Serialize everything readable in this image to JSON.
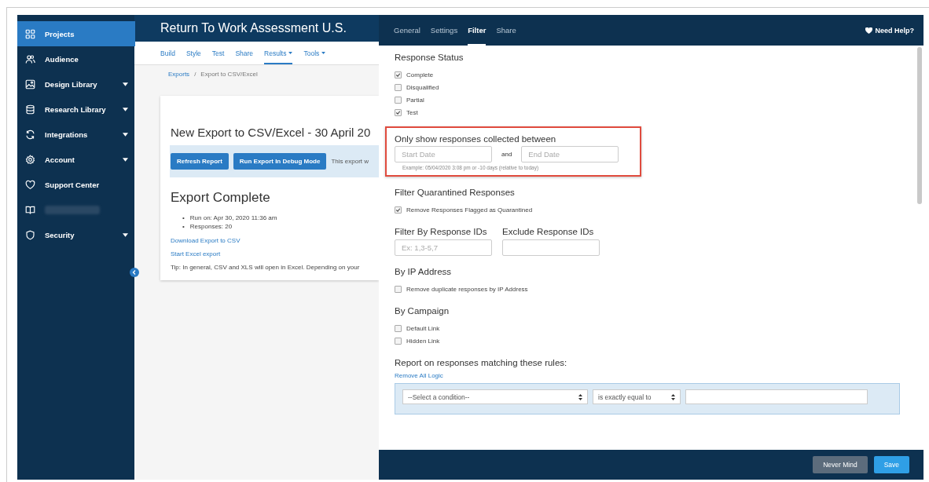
{
  "sidebar": {
    "items": [
      {
        "kind": "link",
        "label": "Projects",
        "selected": true,
        "expandable": false
      },
      {
        "kind": "link",
        "label": "Audience",
        "selected": false,
        "expandable": false
      },
      {
        "kind": "link",
        "label": "Design Library",
        "selected": false,
        "expandable": true
      },
      {
        "kind": "link",
        "label": "Research Library",
        "selected": false,
        "expandable": true
      },
      {
        "kind": "link",
        "label": "Integrations",
        "selected": false,
        "expandable": true
      },
      {
        "kind": "link",
        "label": "Account",
        "selected": false,
        "expandable": true
      },
      {
        "kind": "link",
        "label": "Support Center",
        "selected": false,
        "expandable": false
      },
      {
        "kind": "redacted",
        "selected": false,
        "expandable": false
      },
      {
        "kind": "link",
        "label": "Security",
        "selected": false,
        "expandable": true
      }
    ]
  },
  "project": {
    "title": "Return To Work Assessment U.S.",
    "nav": [
      {
        "label": "Build",
        "selected": false,
        "menu": false
      },
      {
        "label": "Style",
        "selected": false,
        "menu": false
      },
      {
        "label": "Test",
        "selected": false,
        "menu": false
      },
      {
        "label": "Share",
        "selected": false,
        "menu": false
      },
      {
        "label": "Results",
        "selected": true,
        "menu": true
      },
      {
        "label": "Tools",
        "selected": false,
        "menu": true
      }
    ],
    "breadcrumb": [
      {
        "label": "Exports",
        "link": true
      },
      {
        "label": "/",
        "link": false
      },
      {
        "label": "Export to CSV/Excel",
        "link": false
      }
    ],
    "card": {
      "title": "New Export to CSV/Excel - 30 April 20",
      "buttons": [
        "Refresh Report",
        "Run Export In Debug Mode"
      ],
      "notice": "This export w",
      "status": "Export Complete",
      "details": [
        {
          "bullet": "•",
          "text": "Run on: Apr 30, 2020 11:36 am"
        },
        {
          "bullet": "•",
          "text": "Responses: 20"
        }
      ],
      "links": [
        "Download Export to CSV",
        "Start Excel export"
      ],
      "tip": "Tip: In general, CSV and XLS will open in Excel. Depending on your"
    }
  },
  "filter_panel": {
    "tabs": [
      {
        "label": "General",
        "selected": false
      },
      {
        "label": "Settings",
        "selected": false
      },
      {
        "label": "Filter",
        "selected": true
      },
      {
        "label": "Share",
        "selected": false
      }
    ],
    "help": "Need Help?",
    "sections": [
      {
        "kind": "checkboxes",
        "heading": "Response Status",
        "options": [
          {
            "label": "Complete",
            "checked": true
          },
          {
            "label": "Disqualified",
            "checked": false
          },
          {
            "label": "Partial",
            "checked": false
          },
          {
            "label": "Test",
            "checked": true
          }
        ]
      },
      {
        "kind": "date_range",
        "heading": "Only show responses collected between",
        "highlighted": true,
        "start_placeholder": "Start Date",
        "joiner": "and",
        "end_placeholder": "End Date",
        "hint": "Example: 05/04/2020 3:08 pm or -10 days (relative to today)"
      },
      {
        "kind": "checkboxes",
        "heading": "Filter Quarantined Responses",
        "options": [
          {
            "label": "Remove Responses Flagged as Quarantined",
            "checked": true
          }
        ]
      },
      {
        "kind": "id_fields",
        "fields": [
          {
            "label": "Filter By Response IDs",
            "placeholder": "Ex: 1,3-5,7"
          },
          {
            "label": "Exclude Response IDs"
          }
        ]
      },
      {
        "kind": "checkboxes",
        "heading": "By IP Address",
        "options": [
          {
            "label": "Remove duplicate responses by IP Address",
            "checked": false
          }
        ]
      },
      {
        "kind": "checkboxes",
        "heading": "By Campaign",
        "options": [
          {
            "label": "Default Link",
            "checked": false
          },
          {
            "label": "Hidden Link",
            "checked": false
          }
        ]
      },
      {
        "kind": "rules",
        "heading": "Report on responses matching these rules:",
        "link": "Remove All Logic",
        "condition": "--Select a condition--",
        "operator": "is exactly equal to"
      }
    ],
    "buttons": [
      {
        "label": "Never Mind",
        "kind": "secondary"
      },
      {
        "label": "Save",
        "kind": "primary"
      }
    ]
  }
}
